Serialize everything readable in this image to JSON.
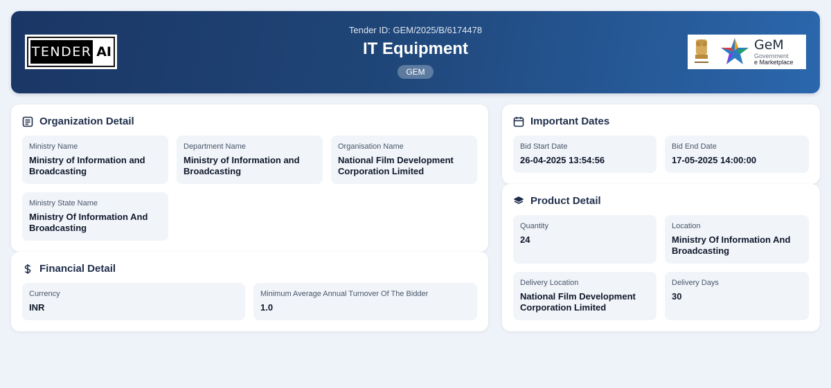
{
  "header": {
    "logo_left": {
      "word": "TENDER",
      "suffix": "AI"
    },
    "tender_id": "Tender ID: GEM/2025/B/6174478",
    "title": "IT Equipment",
    "badge": "GEM",
    "logo_right": {
      "title": "GeM",
      "line1": "Government",
      "line2": "e Marketplace"
    }
  },
  "organization": {
    "title": "Organization Detail",
    "icon": "document-list-icon",
    "fields": [
      {
        "label": "Ministry Name",
        "value": "Ministry of Information and Broadcasting"
      },
      {
        "label": "Department Name",
        "value": "Ministry of Information and Broadcasting"
      },
      {
        "label": "Organisation Name",
        "value": "National Film Development Corporation Limited"
      },
      {
        "label": "Ministry State Name",
        "value": "Ministry Of Information And Broadcasting"
      }
    ]
  },
  "financial": {
    "title": "Financial Detail",
    "icon": "dollar-icon",
    "fields": [
      {
        "label": "Currency",
        "value": "INR"
      },
      {
        "label": "Minimum Average Annual Turnover Of The Bidder",
        "value": "1.0"
      }
    ]
  },
  "dates": {
    "title": "Important Dates",
    "icon": "calendar-icon",
    "fields": [
      {
        "label": "Bid Start Date",
        "value": "26-04-2025 13:54:56"
      },
      {
        "label": "Bid End Date",
        "value": "17-05-2025 14:00:00"
      }
    ]
  },
  "product": {
    "title": "Product Detail",
    "icon": "layers-icon",
    "fields": [
      {
        "label": "Quantity",
        "value": "24"
      },
      {
        "label": "Location",
        "value": "Ministry Of Information And Broadcasting"
      },
      {
        "label": "Delivery Location",
        "value": "National Film Development Corporation Limited"
      },
      {
        "label": "Delivery Days",
        "value": "30"
      }
    ]
  }
}
